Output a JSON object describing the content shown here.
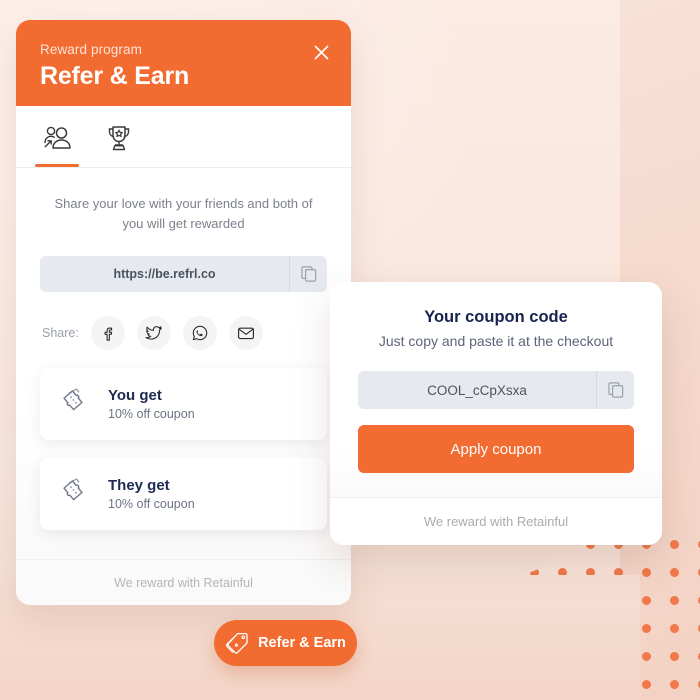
{
  "theme": {
    "accent": "#F26B30",
    "background": "#F7E2D8",
    "input_bg": "#E6EAEE",
    "dot_color": "#F0784A",
    "heading_color": "#16234E"
  },
  "widget": {
    "header": {
      "eyebrow": "Reward program",
      "title": "Refer & Earn",
      "close_icon": "close-icon"
    },
    "tabs": [
      {
        "id": "refer",
        "icon": "referral-people-icon",
        "active": true
      },
      {
        "id": "rewards",
        "icon": "trophy-icon",
        "active": false
      }
    ],
    "share": {
      "tagline": "Share your love with your friends and both of you will get rewarded",
      "link_value": "https://be.refrl.co",
      "copy_icon": "copy-icon",
      "share_label": "Share:",
      "channels": [
        {
          "id": "facebook",
          "icon": "facebook-icon"
        },
        {
          "id": "twitter",
          "icon": "twitter-icon"
        },
        {
          "id": "whatsapp",
          "icon": "whatsapp-icon"
        },
        {
          "id": "email",
          "icon": "email-icon"
        }
      ]
    },
    "rewards": [
      {
        "icon": "coupon-tickets-icon",
        "title": "You get",
        "subtitle": "10% off coupon"
      },
      {
        "icon": "coupon-tickets-icon",
        "title": "They get",
        "subtitle": "10% off coupon"
      }
    ],
    "footer": "We reward with Retainful"
  },
  "coupon": {
    "title": "Your coupon code",
    "subtitle": "Just copy and paste it at the checkout",
    "code": "COOL_cCpXsxa",
    "copy_icon": "copy-icon",
    "apply_label": "Apply coupon",
    "footer": "We reward with Retainful"
  },
  "fab": {
    "label": "Refer & Earn",
    "icon": "price-tag-icon"
  }
}
